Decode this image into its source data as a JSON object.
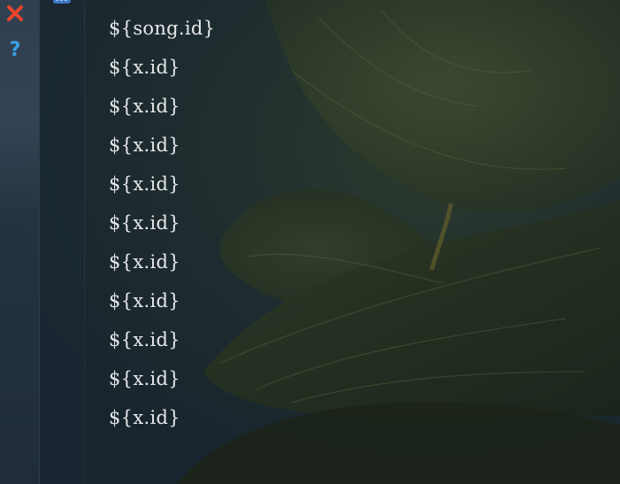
{
  "toolbar": {
    "close_icon": "close-icon",
    "help_label": "?"
  },
  "editor": {
    "lines": [
      "${song.id}",
      "${x.id}",
      "${x.id}",
      "${x.id}",
      "${x.id}",
      "${x.id}",
      "${x.id}",
      "${x.id}",
      "${x.id}",
      "${x.id}",
      "${x.id}"
    ]
  },
  "colors": {
    "close": "#e8462c",
    "help": "#3aa0e6",
    "code_text": "#e6e8ea"
  }
}
